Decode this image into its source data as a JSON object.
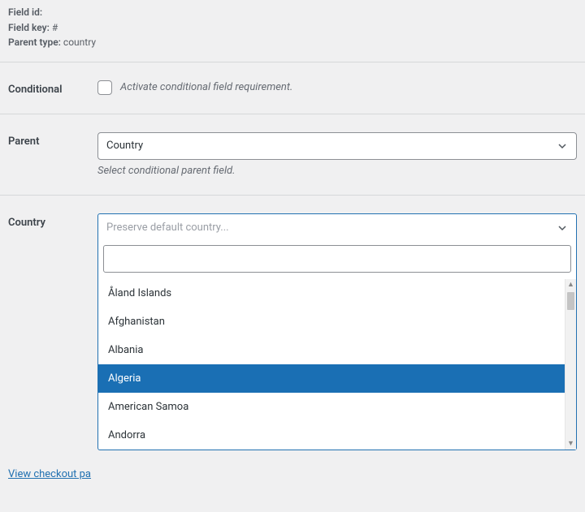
{
  "meta": {
    "field_id_label": "Field id:",
    "field_id_value": "",
    "field_key_label": "Field key:",
    "field_key_value": "#",
    "parent_type_label": "Parent type:",
    "parent_type_value": "country"
  },
  "conditional": {
    "label": "Conditional",
    "help": "Activate conditional field requirement."
  },
  "parent": {
    "label": "Parent",
    "selected": "Country",
    "help": "Select conditional parent field."
  },
  "country": {
    "label": "Country",
    "placeholder": "Preserve default country...",
    "search_value": "",
    "options": [
      {
        "label": "Åland Islands",
        "highlight": false
      },
      {
        "label": "Afghanistan",
        "highlight": false
      },
      {
        "label": "Albania",
        "highlight": false
      },
      {
        "label": "Algeria",
        "highlight": true
      },
      {
        "label": "American Samoa",
        "highlight": false
      },
      {
        "label": "Andorra",
        "highlight": false
      }
    ]
  },
  "link": {
    "text": "View checkout pa"
  }
}
